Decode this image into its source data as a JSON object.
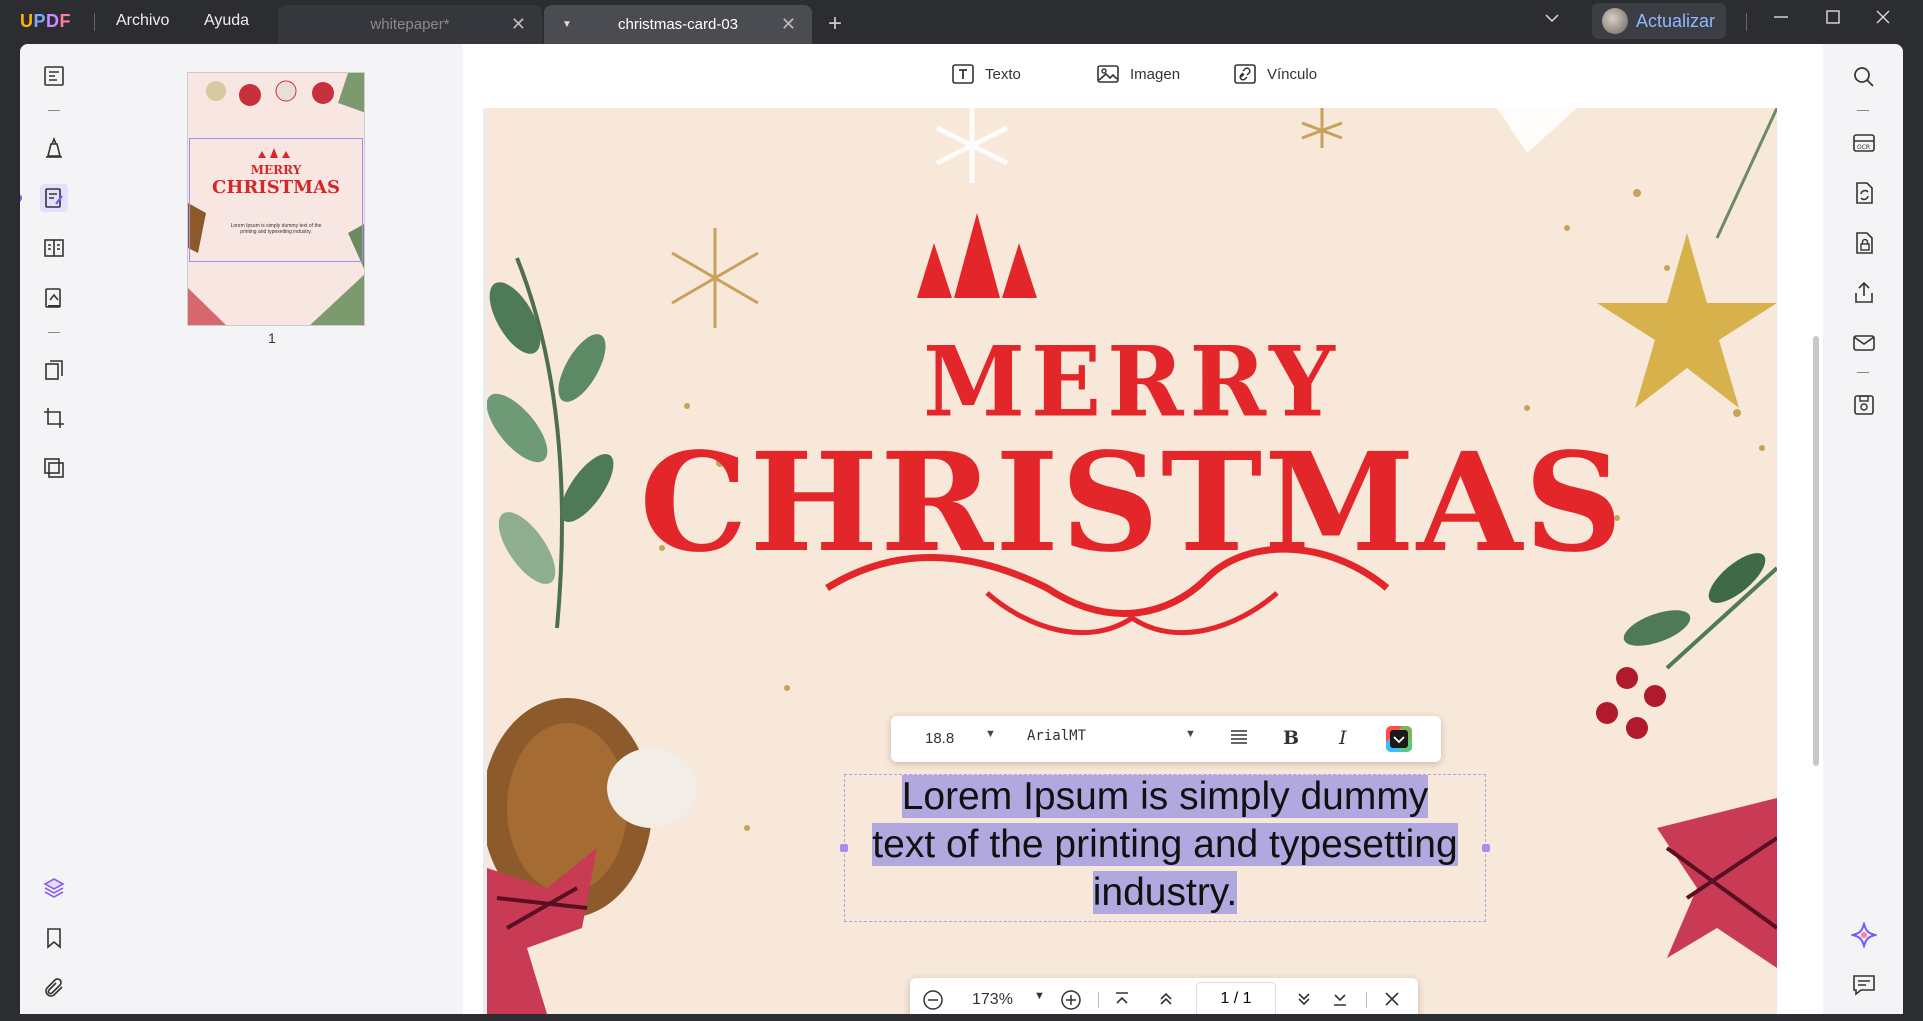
{
  "app": {
    "logo": "UPDF",
    "menu": [
      "Archivo",
      "Ayuda"
    ],
    "tabs": [
      {
        "label": "whitepaper*",
        "active": false
      },
      {
        "label": "christmas-card-03",
        "active": true
      }
    ],
    "upgrade_label": "Actualizar"
  },
  "toolbar": {
    "text_label": "Texto",
    "image_label": "Imagen",
    "link_label": "Vínculo"
  },
  "thumbnail": {
    "page_number": "1",
    "title_line1": "MERRY",
    "title_line2": "CHRISTMAS",
    "text": "Lorem Ipsum is simply dummy text of the printing and typesetting industry."
  },
  "card": {
    "title_line1": "MERRY",
    "title_line2": "CHRISTMAS",
    "text_lines": [
      "Lorem Ipsum is simply dummy",
      "text of the printing and typesetting",
      "industry."
    ],
    "title_color": "#e3262a",
    "background": "#f7e8da"
  },
  "format_bar": {
    "font_size": "18.8",
    "font_name": "ArialMT",
    "bold": "B",
    "italic": "I"
  },
  "nav_bar": {
    "zoom": "173%",
    "page_current": "1",
    "page_total": "1"
  },
  "colors": {
    "accent": "#6e5cf6",
    "selection": "#b0a8de"
  }
}
